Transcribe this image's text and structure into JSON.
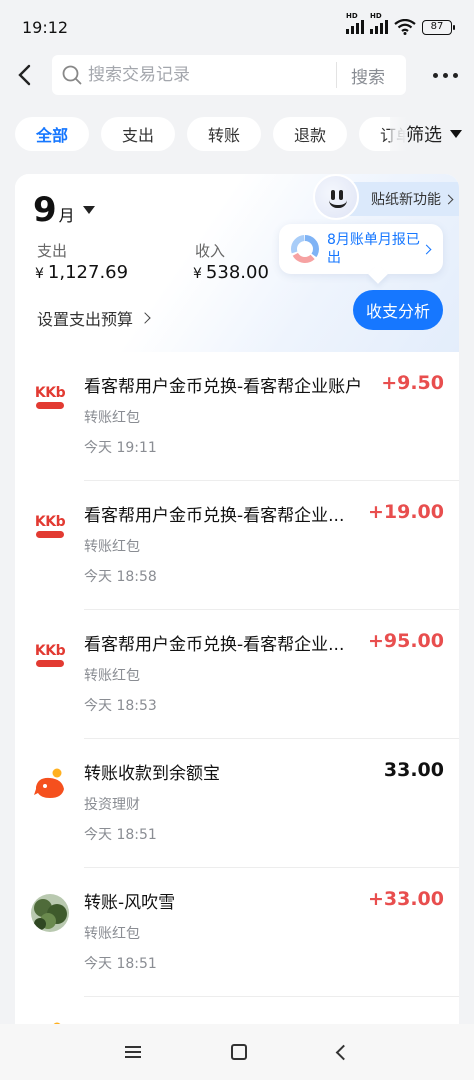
{
  "status_bar": {
    "time": "19:12",
    "battery": "87",
    "network_badge": "HD"
  },
  "header": {
    "search_placeholder": "搜索交易记录",
    "search_button": "搜索"
  },
  "tabs": [
    "全部",
    "支出",
    "转账",
    "退款",
    "订单"
  ],
  "tabs_active_index": 0,
  "filter_label": "筛选",
  "summary": {
    "month_number": "9",
    "month_unit": "月",
    "expense_label": "支出",
    "expense_currency": "¥",
    "expense_value": "1,127.69",
    "income_label": "收入",
    "income_currency": "¥",
    "income_value": "538.00",
    "budget_link": "设置支出预算",
    "sticker_link": "贴纸新功能",
    "report_bubble": "8月账单月报已出",
    "analysis_button": "收支分析"
  },
  "transactions": [
    {
      "title": "看客帮用户金币兑换-看客帮企业账户",
      "category": "转账红包",
      "time": "今天 19:11",
      "amount": "+9.50",
      "direction": "in",
      "icon": "kkb-logo-icon"
    },
    {
      "title": "看客帮用户金币兑换-看客帮企业...",
      "category": "转账红包",
      "time": "今天 18:58",
      "amount": "+19.00",
      "direction": "in",
      "icon": "kkb-logo-icon"
    },
    {
      "title": "看客帮用户金币兑换-看客帮企业...",
      "category": "转账红包",
      "time": "今天 18:53",
      "amount": "+95.00",
      "direction": "in",
      "icon": "kkb-logo-icon"
    },
    {
      "title": "转账收款到余额宝",
      "category": "投资理财",
      "time": "今天 18:51",
      "amount": "33.00",
      "direction": "neutral",
      "icon": "yuebao-icon"
    },
    {
      "title": "转账-风吹雪",
      "category": "转账红包",
      "time": "今天 18:51",
      "amount": "+33.00",
      "direction": "in",
      "icon": "user-avatar"
    }
  ],
  "kkb_logo_text": "KKb",
  "colors": {
    "accent": "#1677ff",
    "income_red": "#e84e4e",
    "background": "#f2f3f5"
  }
}
